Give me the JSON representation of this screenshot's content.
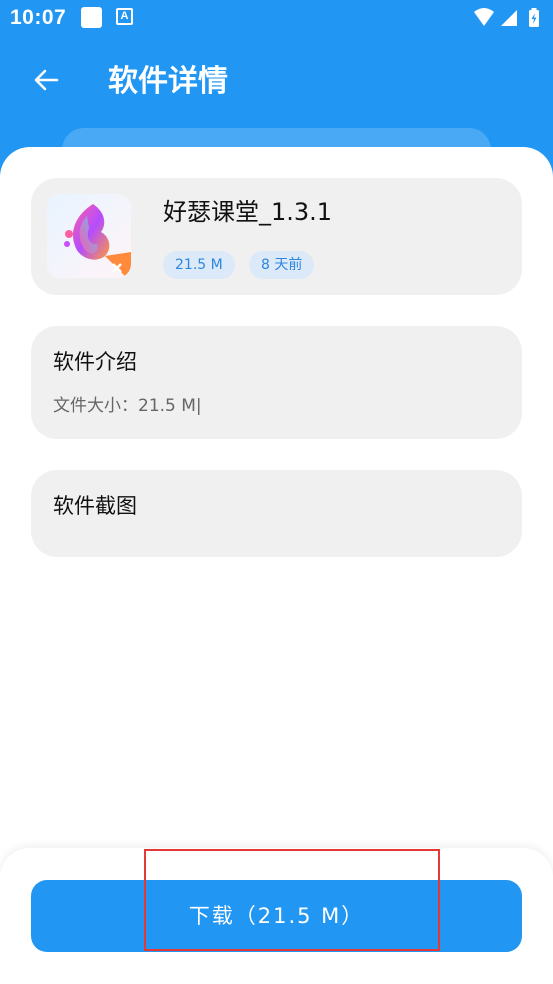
{
  "status_bar": {
    "time": "10:07",
    "notification_icons": [
      "app-notification-icon",
      "font-a-icon"
    ],
    "system_icons": [
      "wifi-icon",
      "cellular-signal-icon",
      "battery-charging-icon"
    ]
  },
  "header": {
    "back_icon": "arrow-left-icon",
    "title": "软件详情"
  },
  "app": {
    "icon": "app-logo-icon",
    "name": "好瑟课堂_1.3.1",
    "size_tag": "21.5 M",
    "time_tag": "8 天前"
  },
  "intro": {
    "title": "软件介绍",
    "file_size_text": "文件大小：21.5 M|"
  },
  "screenshots": {
    "title": "软件截图"
  },
  "download": {
    "label": "下载（21.5 M）"
  },
  "colors": {
    "primary": "#2196f3",
    "card_bg": "#f0f0f0",
    "tag_bg": "#dbe9f8",
    "tag_text": "#2f86dd",
    "highlight": "#e53935"
  }
}
